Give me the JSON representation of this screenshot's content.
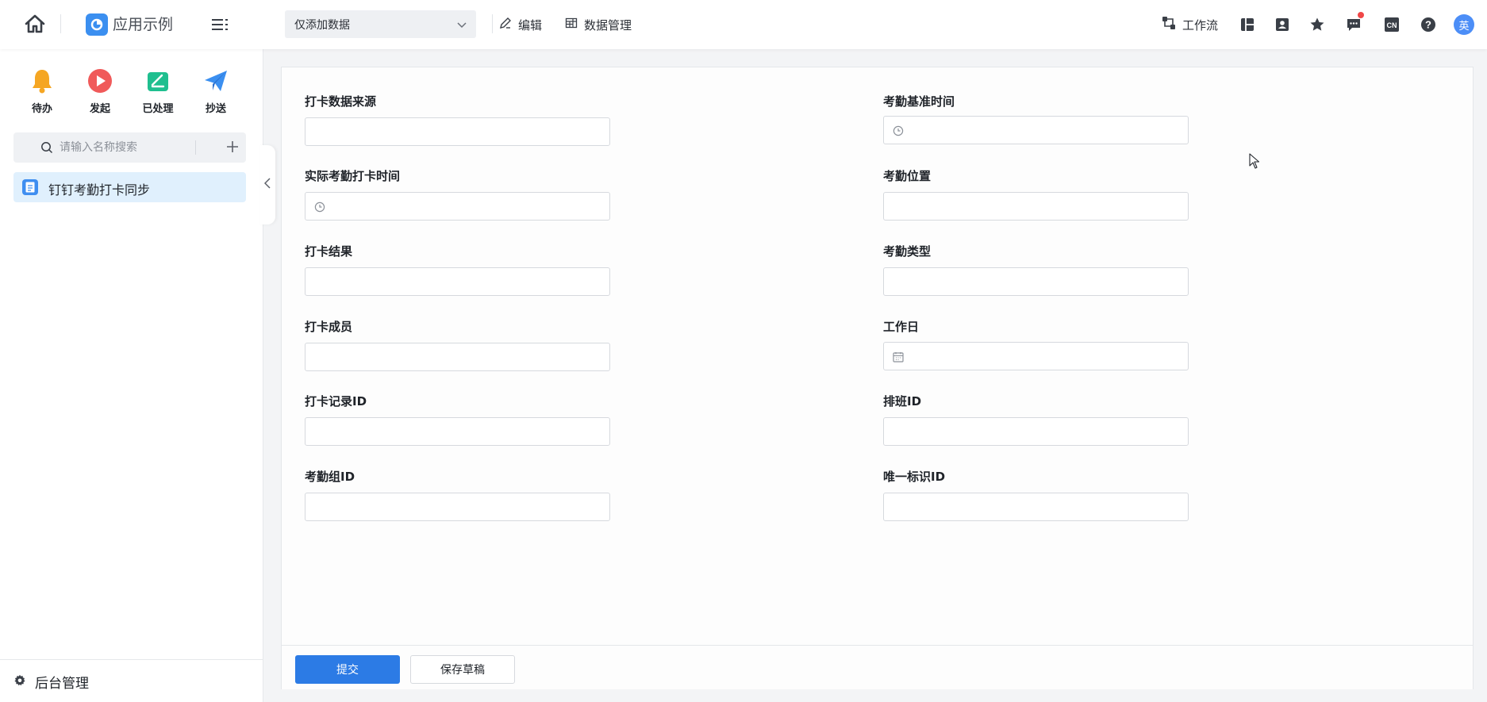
{
  "app": {
    "name": "应用示例"
  },
  "header": {
    "view_select": {
      "value": "仅添加数据"
    },
    "edit_label": "编辑",
    "data_manage_label": "数据管理",
    "workflow_label": "工作流",
    "lang_badge": "CN",
    "avatar_text": "英"
  },
  "colors": {
    "accent": "#2c7be5",
    "nav_active_bg": "#e0f0fd",
    "notification_dot": "#f04747"
  },
  "sidebar": {
    "quick_actions": [
      {
        "label": "待办",
        "icon": "bell-icon",
        "color": "#f5a623"
      },
      {
        "label": "发起",
        "icon": "play-icon",
        "color": "#f05a5a"
      },
      {
        "label": "已处理",
        "icon": "check-tray-icon",
        "color": "#1fbf8f"
      },
      {
        "label": "抄送",
        "icon": "paper-plane-icon",
        "color": "#3b8ff0"
      }
    ],
    "search_placeholder": "请输入名称搜索",
    "items": [
      {
        "label": "钉钉考勤打卡同步",
        "active": true
      }
    ],
    "footer_label": "后台管理"
  },
  "form": {
    "fields_left": [
      {
        "label": "打卡数据来源",
        "value": "",
        "icon": null
      },
      {
        "label": "实际考勤打卡时间",
        "value": "",
        "icon": "clock-icon"
      },
      {
        "label": "打卡结果",
        "value": "",
        "icon": null
      },
      {
        "label": "打卡成员",
        "value": "",
        "icon": null
      },
      {
        "label": "打卡记录ID",
        "value": "",
        "icon": null
      },
      {
        "label": "考勤组ID",
        "value": "",
        "icon": null
      }
    ],
    "fields_right": [
      {
        "label": "考勤基准时间",
        "value": "",
        "icon": "clock-icon"
      },
      {
        "label": "考勤位置",
        "value": "",
        "icon": null
      },
      {
        "label": "考勤类型",
        "value": "",
        "icon": null
      },
      {
        "label": "工作日",
        "value": "",
        "icon": "calendar-icon"
      },
      {
        "label": "排班ID",
        "value": "",
        "icon": null
      },
      {
        "label": "唯一标识ID",
        "value": "",
        "icon": null
      }
    ],
    "submit_label": "提交",
    "draft_label": "保存草稿"
  }
}
